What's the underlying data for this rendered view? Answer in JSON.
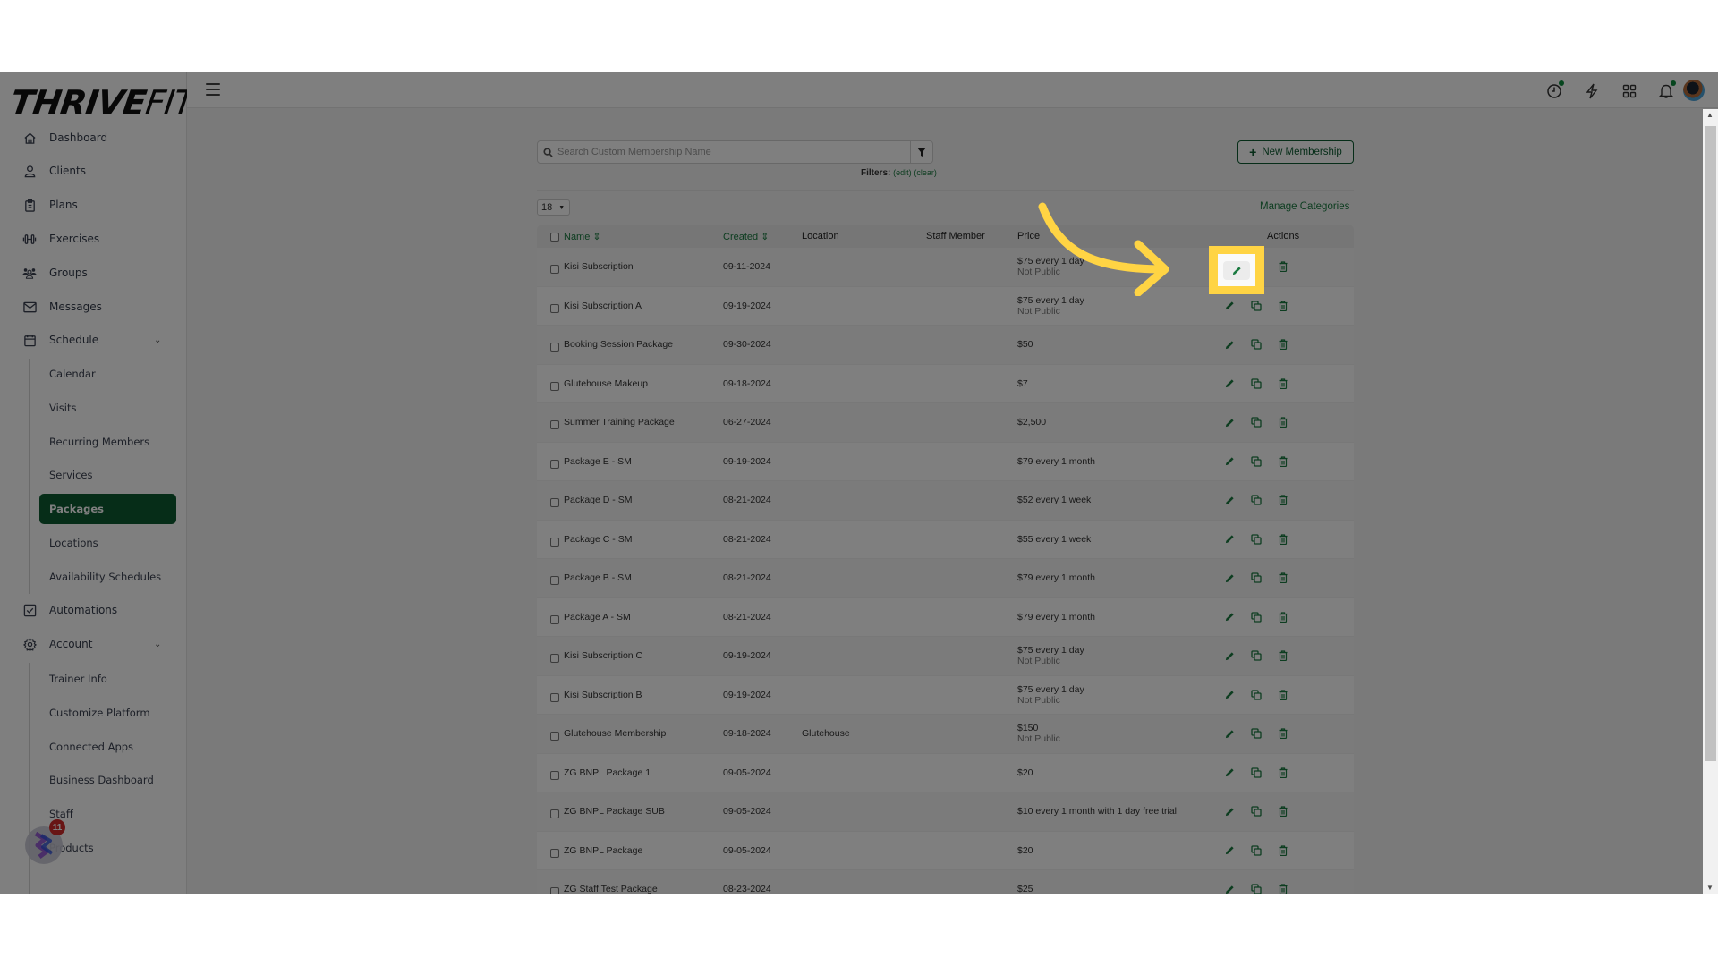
{
  "brand": {
    "logo_bold": "THRIVE",
    "logo_light": "FIT"
  },
  "sidebar": {
    "items": [
      {
        "label": "Dashboard",
        "icon": "home-icon"
      },
      {
        "label": "Clients",
        "icon": "user-icon"
      },
      {
        "label": "Plans",
        "icon": "clipboard-icon"
      },
      {
        "label": "Exercises",
        "icon": "dumbbell-icon"
      },
      {
        "label": "Groups",
        "icon": "users-icon"
      },
      {
        "label": "Messages",
        "icon": "envelope-icon"
      },
      {
        "label": "Schedule",
        "icon": "calendar-icon",
        "expanded": true
      },
      {
        "label": "Automations",
        "icon": "checkbox-icon"
      },
      {
        "label": "Account",
        "icon": "gear-icon",
        "expanded": true
      }
    ],
    "schedule_sub": [
      "Calendar",
      "Visits",
      "Recurring Members",
      "Services",
      "Packages",
      "Locations",
      "Availability Schedules"
    ],
    "account_sub": [
      "Trainer Info",
      "Customize Platform",
      "Connected Apps",
      "Business Dashboard",
      "Staff",
      "Products"
    ],
    "active": "Packages"
  },
  "topbar": {
    "icons": [
      "clock-icon",
      "bolt-icon",
      "grid-icon",
      "bell-icon"
    ],
    "clock_has_notification": true,
    "bell_has_notification": true
  },
  "toolbar": {
    "search_placeholder": "Search Custom Membership Name",
    "search_value": "",
    "filters_label": "Filters:",
    "filters_edit": "(edit)",
    "filters_clear": "(clear)",
    "new_button": "New Membership",
    "page_size": "18",
    "manage_categories": "Manage Categories"
  },
  "table": {
    "columns": {
      "name": "Name",
      "created": "Created",
      "location": "Location",
      "staff": "Staff Member",
      "price": "Price",
      "actions": "Actions"
    },
    "rows": [
      {
        "name": "Kisi Subscription",
        "created": "09-11-2024",
        "location": "",
        "staff": "",
        "price": "$75 every 1 day",
        "note": "Not Public"
      },
      {
        "name": "Kisi Subscription A",
        "created": "09-19-2024",
        "location": "",
        "staff": "",
        "price": "$75 every 1 day",
        "note": "Not Public"
      },
      {
        "name": "Booking Session Package",
        "created": "09-30-2024",
        "location": "",
        "staff": "",
        "price": "$50",
        "note": ""
      },
      {
        "name": "Glutehouse Makeup",
        "created": "09-18-2024",
        "location": "",
        "staff": "",
        "price": "$7",
        "note": ""
      },
      {
        "name": "Summer Training Package",
        "created": "06-27-2024",
        "location": "",
        "staff": "",
        "price": "$2,500",
        "note": ""
      },
      {
        "name": "Package E - SM",
        "created": "09-19-2024",
        "location": "",
        "staff": "",
        "price": "$79 every 1 month",
        "note": ""
      },
      {
        "name": "Package D - SM",
        "created": "08-21-2024",
        "location": "",
        "staff": "",
        "price": "$52 every 1 week",
        "note": ""
      },
      {
        "name": "Package C - SM",
        "created": "08-21-2024",
        "location": "",
        "staff": "",
        "price": "$55 every 1 week",
        "note": ""
      },
      {
        "name": "Package B - SM",
        "created": "08-21-2024",
        "location": "",
        "staff": "",
        "price": "$79 every 1 month",
        "note": ""
      },
      {
        "name": "Package A - SM",
        "created": "08-21-2024",
        "location": "",
        "staff": "",
        "price": "$79 every 1 month",
        "note": ""
      },
      {
        "name": "Kisi Subscription C",
        "created": "09-19-2024",
        "location": "",
        "staff": "",
        "price": "$75 every 1 day",
        "note": "Not Public"
      },
      {
        "name": "Kisi Subscription B",
        "created": "09-19-2024",
        "location": "",
        "staff": "",
        "price": "$75 every 1 day",
        "note": "Not Public"
      },
      {
        "name": "Glutehouse Membership",
        "created": "09-18-2024",
        "location": "Glutehouse",
        "staff": "",
        "price": "$150",
        "note": "Not Public"
      },
      {
        "name": "ZG BNPL Package 1",
        "created": "09-05-2024",
        "location": "",
        "staff": "",
        "price": "$20",
        "note": ""
      },
      {
        "name": "ZG BNPL Package SUB",
        "created": "09-05-2024",
        "location": "",
        "staff": "",
        "price": "$10 every 1 month with 1 day free trial",
        "note": ""
      },
      {
        "name": "ZG BNPL Package",
        "created": "09-05-2024",
        "location": "",
        "staff": "",
        "price": "$20",
        "note": ""
      },
      {
        "name": "ZG Staff Test Package",
        "created": "08-23-2024",
        "location": "",
        "staff": "",
        "price": "$25",
        "note": ""
      }
    ]
  },
  "widget": {
    "badge_count": "11"
  },
  "annotation": {
    "target": "edit-button row 1",
    "color": "#ffd444"
  },
  "colors": {
    "brand_green": "#0c5a30",
    "link_green": "#1a7a40",
    "highlight_yellow": "#ffd444",
    "badge_red": "#cc1414"
  }
}
